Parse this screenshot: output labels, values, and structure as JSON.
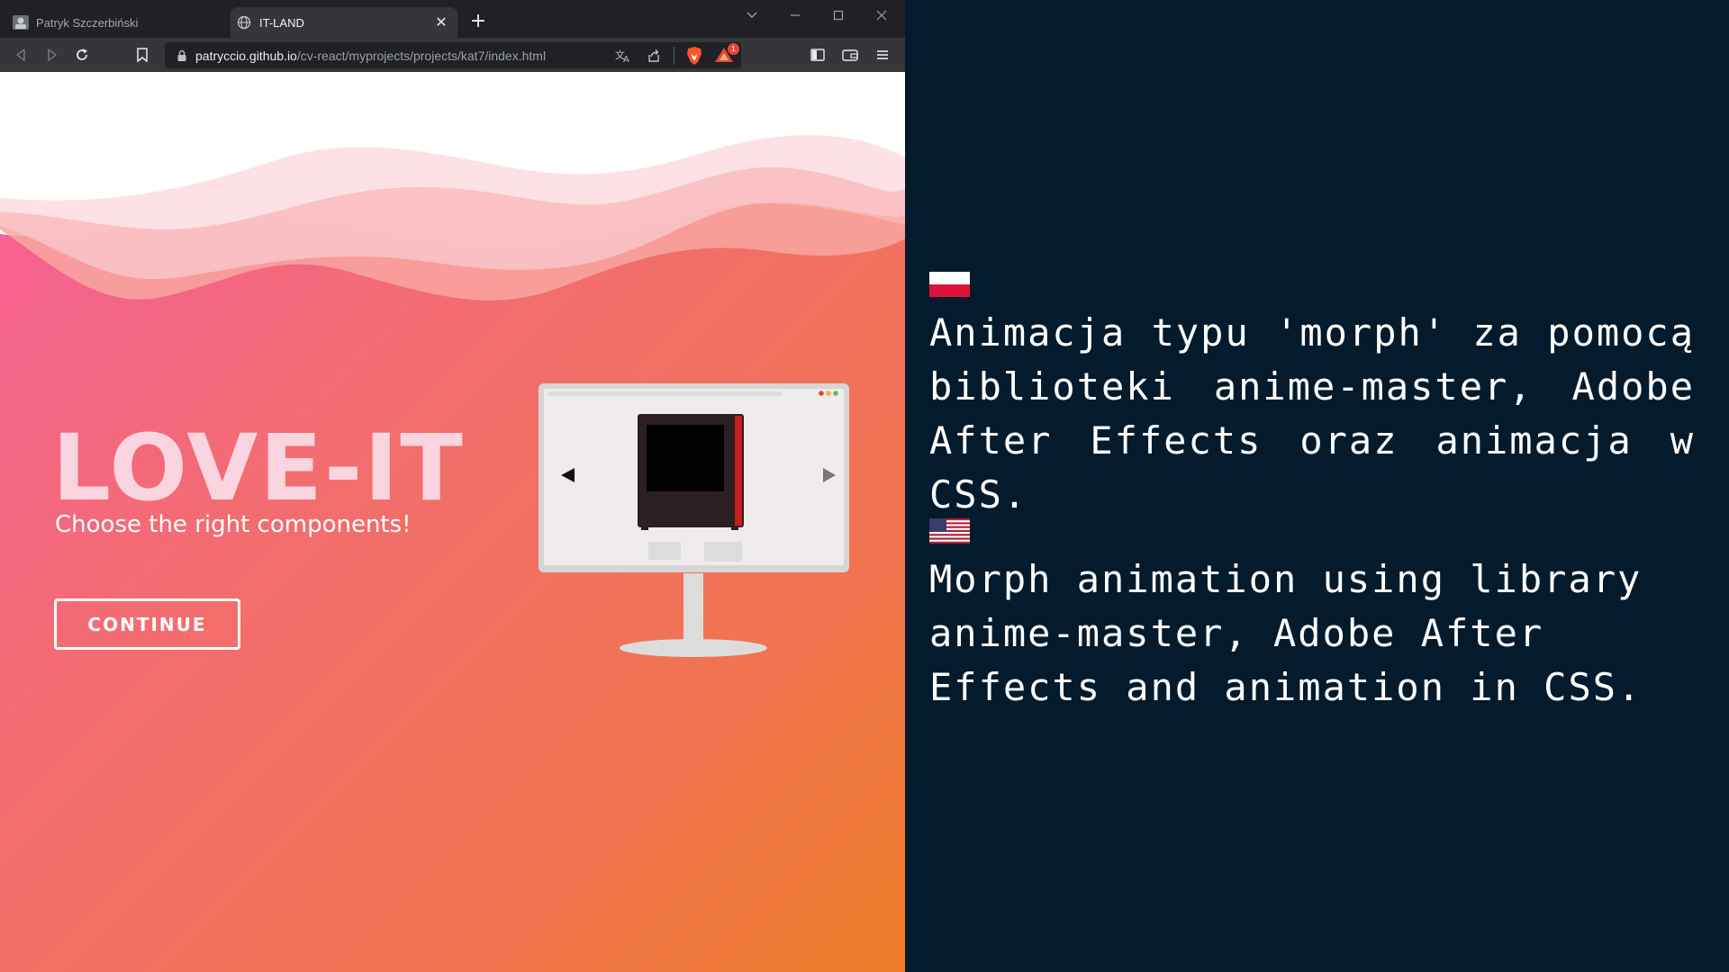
{
  "browser": {
    "tabs": [
      {
        "title": "Patryk Szczerbiński",
        "active": false
      },
      {
        "title": "IT-LAND",
        "active": true
      }
    ],
    "url": {
      "host": "patryccio.github.io",
      "path": "/cv-react/myprojects/projects/kat7/index.html"
    },
    "rewards_badge": "1",
    "icons": {
      "back": "back-arrow-icon",
      "forward": "forward-arrow-icon",
      "reload": "reload-icon",
      "bookmark": "bookmark-icon",
      "lock": "lock-icon",
      "translate": "translate-icon",
      "share": "share-icon",
      "shield": "brave-shield-icon",
      "rewards": "brave-rewards-icon",
      "sidebar": "sidebar-icon",
      "wallet": "wallet-icon",
      "menu": "menu-icon"
    }
  },
  "page": {
    "logo": "LOVE-IT",
    "tagline": "Choose the right components!",
    "cta": "CONTINUE",
    "colors": {
      "gradient_start": "#f65e9c",
      "gradient_end": "#ee7c27",
      "logo": "#fad5df"
    }
  },
  "panel": {
    "pl_text": "Animacja typu 'morph' za pomocą biblioteki anime-master, Adobe After Effects oraz animacja w CSS.",
    "en_text": "Morph animation using library anime-master, Adobe After Effects and animation in CSS.",
    "background": "#031b2c"
  }
}
